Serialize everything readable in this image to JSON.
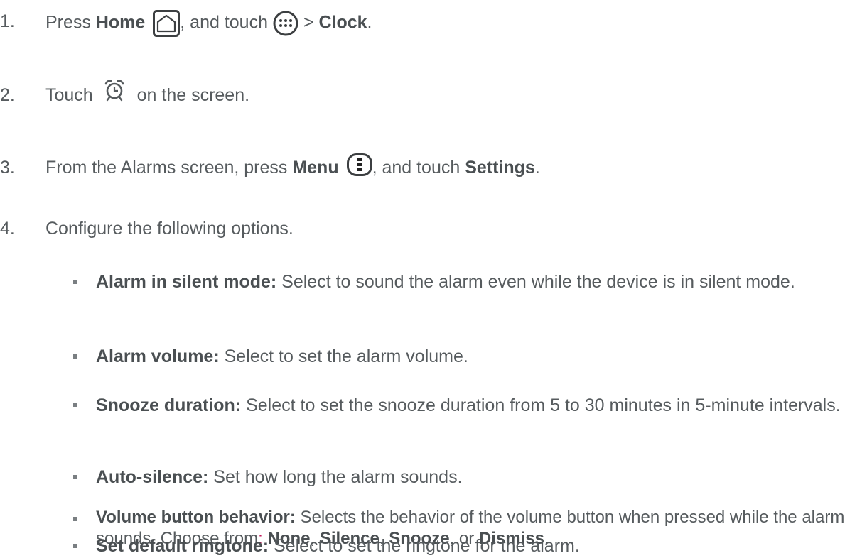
{
  "steps": [
    {
      "num": "1.",
      "parts": {
        "p1": "Press ",
        "home": "Home",
        "p2": ", and touch ",
        "p3": " > ",
        "clock": "Clock",
        "p4": "."
      }
    },
    {
      "num": "2.",
      "parts": {
        "p1": "Touch ",
        "p2": " on the screen."
      }
    },
    {
      "num": "3.",
      "parts": {
        "p1": "From the Alarms screen, press ",
        "menu": "Menu",
        "p2": ", and touch ",
        "settings": "Settings",
        "p3": "."
      }
    },
    {
      "num": "4.",
      "parts": {
        "p1": "Configure the following options."
      }
    }
  ],
  "options": [
    {
      "term": "Alarm in silent mode:",
      "desc": " Select to sound the alarm even while the device is in silent mode."
    },
    {
      "term": "Alarm volume:",
      "desc": " Select to set the alarm volume."
    },
    {
      "term": "Snooze duration:",
      "desc": " Select to set the snooze duration from 5 to 30 minutes in 5-minute intervals."
    },
    {
      "term": "Auto-silence:",
      "desc": " Set how long the alarm sounds."
    },
    {
      "term": "Volume button behavior:",
      "desc": " Selects the behavior of the volume button when pressed while the alarm sounds. Choose from",
      "colon": ":",
      "choices": {
        "none": "None",
        "silence": "Silence",
        "snooze": "Snooze",
        "dismiss": "Dismiss"
      },
      "sep1": ", ",
      "sep2": ", ",
      "sep3": ", or ",
      "end": "."
    },
    {
      "term": "Set default ringtone:",
      "desc": " Select to set the ringtone for the alarm."
    }
  ],
  "icons": {
    "home": "home-key-icon",
    "apps": "apps-launcher-icon",
    "alarm": "alarm-clock-icon",
    "menu": "menu-key-icon"
  },
  "colors": {
    "text": "#565b5e",
    "bullet": "#7a7f82",
    "accent_colon": "#c2185b"
  }
}
